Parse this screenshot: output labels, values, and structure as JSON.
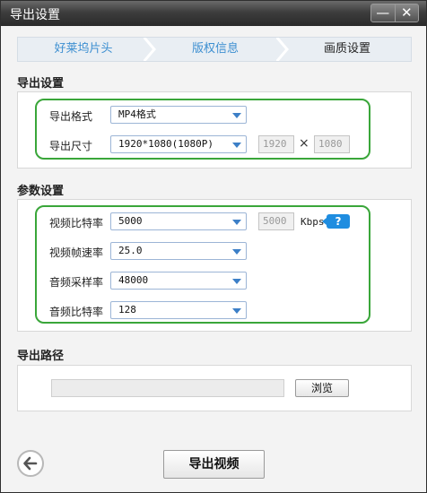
{
  "window": {
    "title": "导出设置",
    "minimize_icon": "minimize-icon",
    "close_icon": "close-icon"
  },
  "steps": [
    {
      "label": "好莱坞片头",
      "active": false
    },
    {
      "label": "版权信息",
      "active": false
    },
    {
      "label": "画质设置",
      "active": true
    }
  ],
  "export_settings": {
    "title": "导出设置",
    "format": {
      "label": "导出格式",
      "value": "MP4格式"
    },
    "size": {
      "label": "导出尺寸",
      "value": "1920*1080(1080P)",
      "width": "1920",
      "separator": "×",
      "height": "1080"
    }
  },
  "params": {
    "title": "参数设置",
    "video_bitrate": {
      "label": "视频比特率",
      "value": "5000",
      "custom_value": "5000",
      "unit": "Kbps",
      "help_label": "?"
    },
    "frame_rate": {
      "label": "视频帧速率",
      "value": "25.0"
    },
    "audio_sample_rate": {
      "label": "音频采样率",
      "value": "48000"
    },
    "audio_bitrate": {
      "label": "音频比特率",
      "value": "128"
    }
  },
  "output_path": {
    "title": "导出路径",
    "value": "",
    "browse_label": "浏览"
  },
  "footer": {
    "export_label": "导出视频",
    "back_icon": "back-arrow-icon"
  },
  "colors": {
    "accent_green": "#3aa63a",
    "link_blue": "#3d8fd1",
    "help_blue": "#1f8de0",
    "titlebar": "#3d3d3d"
  }
}
